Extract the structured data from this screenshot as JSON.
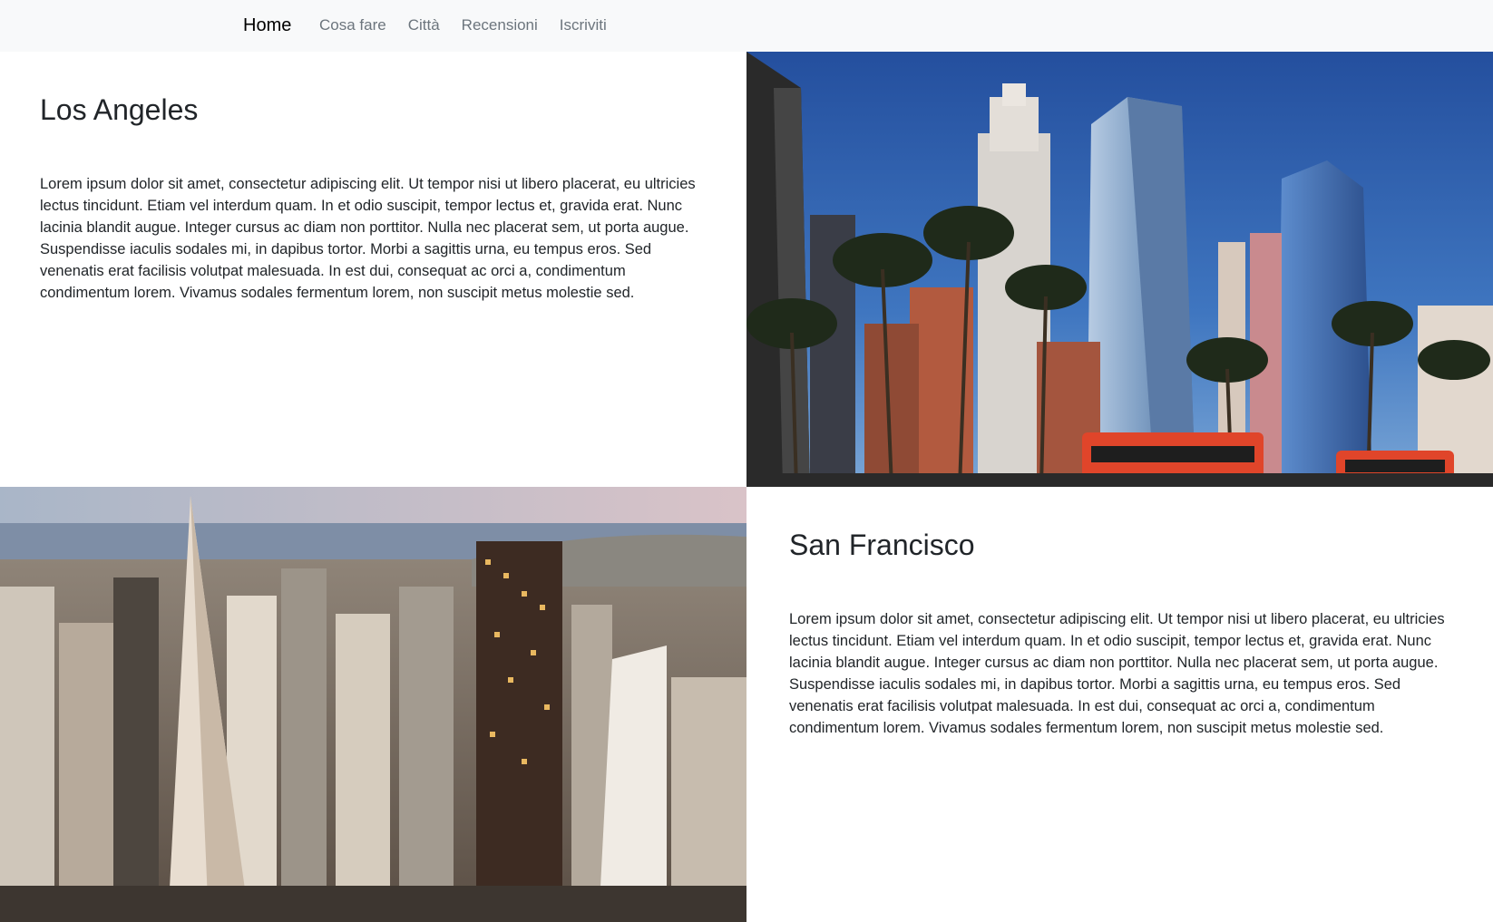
{
  "nav": {
    "brand": "Home",
    "links": [
      "Cosa fare",
      "Città",
      "Recensioni",
      "Iscriviti"
    ]
  },
  "sections": [
    {
      "title": "Los Angeles",
      "text": "Lorem ipsum dolor sit amet, consectetur adipiscing elit. Ut tempor nisi ut libero placerat, eu ultricies lectus tincidunt. Etiam vel interdum quam. In et odio suscipit, tempor lectus et, gravida erat. Nunc lacinia blandit augue. Integer cursus ac diam non porttitor. Nulla nec placerat sem, ut porta augue. Suspendisse iaculis sodales mi, in dapibus tortor. Morbi a sagittis urna, eu tempus eros. Sed venenatis erat facilisis volutpat malesuada. In est dui, consequat ac orci a, condimentum condimentum lorem. Vivamus sodales fermentum lorem, non suscipit metus molestie sed.",
      "image": "los-angeles-skyline-photo"
    },
    {
      "title": "San Francisco",
      "text": "Lorem ipsum dolor sit amet, consectetur adipiscing elit. Ut tempor nisi ut libero placerat, eu ultricies lectus tincidunt. Etiam vel interdum quam. In et odio suscipit, tempor lectus et, gravida erat. Nunc lacinia blandit augue. Integer cursus ac diam non porttitor. Nulla nec placerat sem, ut porta augue. Suspendisse iaculis sodales mi, in dapibus tortor. Morbi a sagittis urna, eu tempus eros. Sed venenatis erat facilisis volutpat malesuada. In est dui, consequat ac orci a, condimentum condimentum lorem. Vivamus sodales fermentum lorem, non suscipit metus molestie sed.",
      "image": "san-francisco-aerial-photo"
    }
  ],
  "colors": {
    "navbar_bg": "#f8f9fa",
    "nav_link": "#6c757d",
    "text": "#212529",
    "sky_blue": "#2f5fae",
    "bus_red": "#e0452a"
  }
}
